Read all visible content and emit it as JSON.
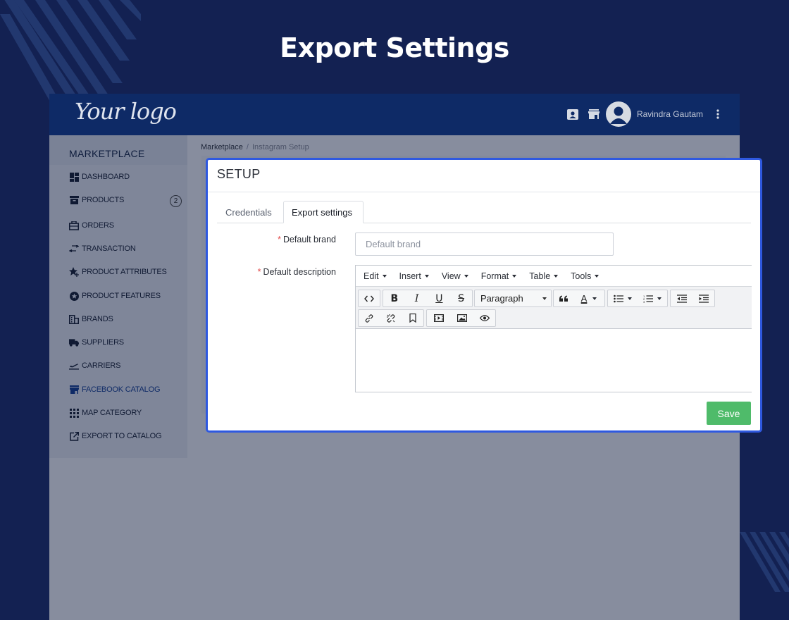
{
  "page": {
    "title": "Export Settings"
  },
  "header": {
    "logo_text": "Your logo",
    "user_name": "Ravindra Gautam",
    "icons": [
      "contact-card-icon",
      "store-icon",
      "user-avatar-icon",
      "kebab-menu-icon"
    ]
  },
  "sidebar": {
    "title": "MARKETPLACE",
    "items": [
      {
        "label": "DASHBOARD",
        "icon": "dashboard-icon"
      },
      {
        "label": "PRODUCTS",
        "icon": "archive-icon",
        "badge": "2"
      },
      {
        "label": "ORDERS",
        "icon": "briefcase-icon"
      },
      {
        "label": "TRANSACTION",
        "icon": "exchange-icon"
      },
      {
        "label": "PRODUCT ATTRIBUTES",
        "icon": "star-plus-icon"
      },
      {
        "label": "PRODUCT FEATURES",
        "icon": "star-circle-icon"
      },
      {
        "label": "BRANDS",
        "icon": "building-icon"
      },
      {
        "label": "SUPPLIERS",
        "icon": "truck-icon"
      },
      {
        "label": "CARRIERS",
        "icon": "plane-departure-icon"
      },
      {
        "label": "FACEBOOK CATALOG",
        "icon": "store-icon",
        "active": true
      },
      {
        "label": "MAP CATEGORY",
        "icon": "grid-icon"
      },
      {
        "label": "EXPORT TO CATALOG",
        "icon": "external-link-icon"
      }
    ]
  },
  "breadcrumb": {
    "root": "Marketplace",
    "separator": "/",
    "current": "Instagram Setup"
  },
  "modal": {
    "title": "SETUP",
    "tabs": [
      {
        "label": "Credentials",
        "active": false
      },
      {
        "label": "Export settings",
        "active": true
      }
    ],
    "form": {
      "brand_label": "Default brand",
      "brand_placeholder": "Default brand",
      "brand_value": "",
      "description_label": "Default description",
      "required_mark": "*"
    },
    "editor": {
      "menus": [
        "Edit",
        "Insert",
        "View",
        "Format",
        "Table",
        "Tools"
      ],
      "format_select": "Paragraph",
      "content": ""
    },
    "save_label": "Save"
  },
  "colors": {
    "background": "#132152",
    "header": "#0e2a66",
    "modal_border": "#2f59e0",
    "save_button": "#4fbb6a",
    "required": "#e24a4a"
  }
}
